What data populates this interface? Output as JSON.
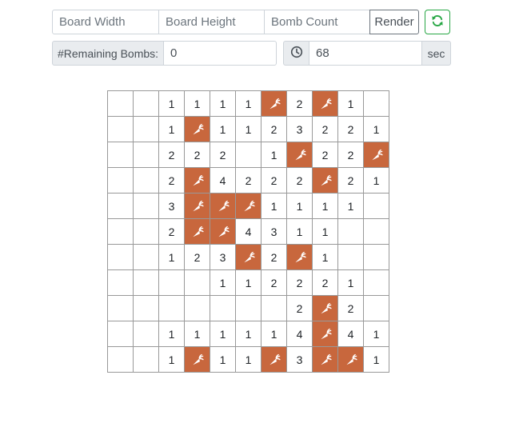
{
  "controls": {
    "width_placeholder": "Board Width",
    "height_placeholder": "Board Height",
    "bomb_placeholder": "Bomb Count",
    "render_label": "Render",
    "refresh_icon": "refresh-icon",
    "remaining_label": "#Remaining Bombs:",
    "remaining_value": "0",
    "timer_icon": "clock-icon",
    "timer_value": "68",
    "timer_unit": "sec"
  },
  "colors": {
    "bomb_cell": "#c8673d",
    "refresh_accent": "#28a745",
    "grid_line": "#999999"
  },
  "board": {
    "bomb_icon": "carrot-icon",
    "rows": [
      [
        "",
        "",
        "1",
        "1",
        "1",
        "1",
        "B",
        "2",
        "B",
        "1",
        ""
      ],
      [
        "",
        "",
        "1",
        "B",
        "1",
        "1",
        "2",
        "3",
        "2",
        "2",
        "1"
      ],
      [
        "",
        "",
        "2",
        "2",
        "2",
        "",
        "1",
        "B",
        "2",
        "2",
        "B"
      ],
      [
        "",
        "",
        "2",
        "B",
        "4",
        "2",
        "2",
        "2",
        "B",
        "2",
        "1"
      ],
      [
        "",
        "",
        "3",
        "B",
        "B",
        "B",
        "1",
        "1",
        "1",
        "1",
        ""
      ],
      [
        "",
        "",
        "2",
        "B",
        "B",
        "4",
        "3",
        "1",
        "1",
        "",
        ""
      ],
      [
        "",
        "",
        "1",
        "2",
        "3",
        "B",
        "2",
        "B",
        "1",
        "",
        ""
      ],
      [
        "",
        "",
        "",
        "",
        "1",
        "1",
        "2",
        "2",
        "2",
        "1",
        ""
      ],
      [
        "",
        "",
        "",
        "",
        "",
        "",
        "",
        "2",
        "B",
        "2",
        ""
      ],
      [
        "",
        "",
        "1",
        "1",
        "1",
        "1",
        "1",
        "4",
        "B",
        "4",
        "1"
      ],
      [
        "",
        "",
        "1",
        "B",
        "1",
        "1",
        "B",
        "3",
        "B",
        "B",
        "1"
      ]
    ]
  }
}
